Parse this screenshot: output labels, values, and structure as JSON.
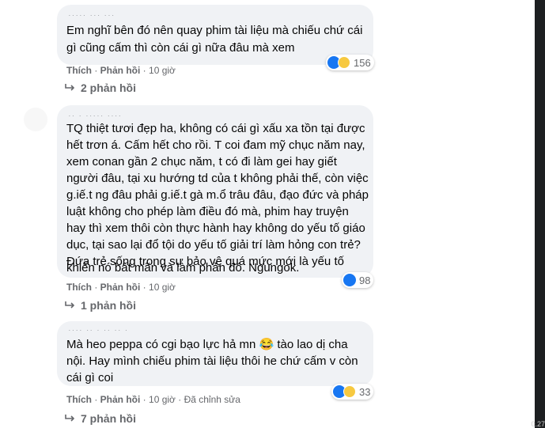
{
  "comments": [
    {
      "name_redacted": "····· ··· ···",
      "lines": [
        "Em nghĩ bên đó nên quay phim tài liệu mà chiếu chứ cái",
        "gì cũng cấm thì còn cái gì nữa đâu mà xem"
      ],
      "like_label": "Thích",
      "reply_label": "Phản hồi",
      "time": "10 giờ",
      "edited": "",
      "reaction_count": "156",
      "replies_label": "2 phản hồi"
    },
    {
      "name_redacted": "·· · ····· ····",
      "lines": [
        "TQ thiệt tươi đẹp ha, không có cái gì xấu xa tồn tại được",
        "hết trơn á. Cấm hết cho rồi. T coi đam mỹ chục năm nay,",
        "xem conan gần 2 chục năm, t có đi làm gei hay giết",
        "người đâu, tại xu hướng td của t không phải thế, còn việc",
        "g.iế.t ng đâu phải g.iế.t gà m.ổ trâu đâu, đạo đức và pháp",
        "luật không cho phép làm điều đó mà, phim hay truyện",
        "hay thì xem thôi còn thực hành hay không do yếu tố giáo",
        "dục, tại sao lại đổ tội do yếu tố giải trí làm hỏng con trẻ?",
        "Đứa trẻ sống trong sự bảo vệ quá mức mới là yếu tố",
        "khiến nó bất mãn và làm phản đó. Ngungok."
      ],
      "like_label": "Thích",
      "reply_label": "Phản hồi",
      "time": "10 giờ",
      "edited": "",
      "reaction_count": "98",
      "replies_label": "1 phản hồi"
    },
    {
      "name_redacted": "···· ·· · ·· ·· ·",
      "lines": [
        "Mà heo peppa có cgi bạo lực hả mn 😂 tào lao dị cha",
        "nội. Hay mình chiếu phim tài liệu thôi he chứ cấm v còn",
        "cái gì coi"
      ],
      "like_label": "Thích",
      "reply_label": "Phản hồi",
      "time": "10 giờ",
      "edited": "Đã chỉnh sửa",
      "reaction_count": "33",
      "replies_label": "7 phản hồi"
    }
  ],
  "corner_number": "0.27",
  "colors": {
    "bubble": "#f0f2f5",
    "like": "#1877f2",
    "haha": "#f7c940",
    "meta": "#65676b"
  }
}
